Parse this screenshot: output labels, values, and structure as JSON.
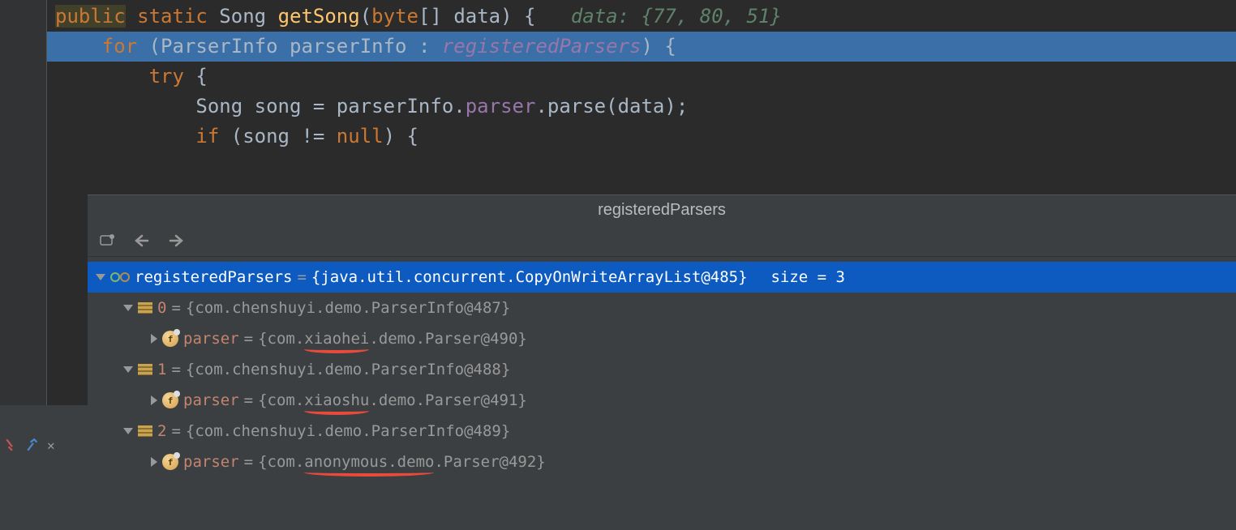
{
  "editor": {
    "lines": [
      {
        "tokens": [
          {
            "text": "public",
            "cls": "kw-public"
          },
          {
            "text": " ",
            "cls": "punct"
          },
          {
            "text": "static",
            "cls": "kw-orange"
          },
          {
            "text": " Song ",
            "cls": "type"
          },
          {
            "text": "getSong",
            "cls": "method"
          },
          {
            "text": "(",
            "cls": "punct"
          },
          {
            "text": "byte",
            "cls": "kw-orange"
          },
          {
            "text": "[] data) {   ",
            "cls": "punct"
          },
          {
            "text": "data: {77, 80, 51}",
            "cls": "hint-green"
          }
        ],
        "highlighted": false
      },
      {
        "tokens": [
          {
            "text": "    ",
            "cls": "punct"
          },
          {
            "text": "for",
            "cls": "kw-orange"
          },
          {
            "text": " (ParserInfo parserInfo : ",
            "cls": "type"
          },
          {
            "text": "registeredParsers",
            "cls": "field"
          },
          {
            "text": ") {",
            "cls": "punct"
          }
        ],
        "highlighted": true
      },
      {
        "tokens": [
          {
            "text": "        ",
            "cls": "punct"
          },
          {
            "text": "try",
            "cls": "kw-orange"
          },
          {
            "text": " {",
            "cls": "punct"
          }
        ],
        "highlighted": false
      },
      {
        "tokens": [
          {
            "text": "            Song song = parserInfo.",
            "cls": "type"
          },
          {
            "text": "parser",
            "cls": "field-normal"
          },
          {
            "text": ".parse(data);",
            "cls": "type"
          }
        ],
        "highlighted": false
      },
      {
        "tokens": [
          {
            "text": "            ",
            "cls": "punct"
          },
          {
            "text": "if",
            "cls": "kw-orange"
          },
          {
            "text": " (song != ",
            "cls": "type"
          },
          {
            "text": "null",
            "cls": "kw-orange"
          },
          {
            "text": ") {",
            "cls": "type"
          }
        ],
        "highlighted": false
      }
    ]
  },
  "debug": {
    "tab_title": "registeredParsers",
    "root": {
      "name": "registeredParsers",
      "value": "{java.util.concurrent.CopyOnWriteArrayList@485}",
      "size_label": "size = 3"
    },
    "items": [
      {
        "index": "0",
        "value": "{com.chenshuyi.demo.ParserInfo@487}",
        "child": {
          "name": "parser",
          "value": "{com.xiaohei.demo.Parser@490}",
          "underline": "xiaohei"
        }
      },
      {
        "index": "1",
        "value": "{com.chenshuyi.demo.ParserInfo@488}",
        "child": {
          "name": "parser",
          "value": "{com.xiaoshu.demo.Parser@491}",
          "underline": "xiaoshu"
        }
      },
      {
        "index": "2",
        "value": "{com.chenshuyi.demo.ParserInfo@489}",
        "child": {
          "name": "parser",
          "value": "{com.anonymous.demo.Parser@492}",
          "underline": "anonymous.demo"
        }
      }
    ]
  }
}
